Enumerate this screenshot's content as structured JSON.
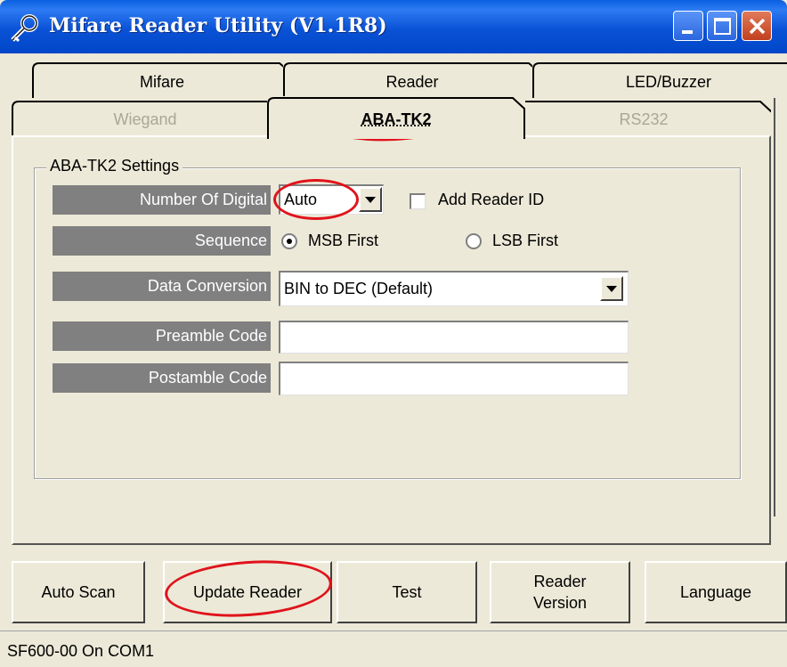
{
  "window": {
    "title": "Mifare Reader Utility (V1.1R8)"
  },
  "tabs": {
    "row1": [
      "Mifare",
      "Reader",
      "LED/Buzzer"
    ],
    "row2": [
      "Wiegand",
      "ABA-TK2",
      "RS232"
    ],
    "active": "ABA-TK2"
  },
  "settings": {
    "group_title": "ABA-TK2 Settings",
    "number_of_digital_label": "Number Of Digital",
    "number_of_digital_value": "Auto",
    "add_reader_id_label": "Add Reader ID",
    "add_reader_id_checked": false,
    "sequence_label": "Sequence",
    "sequence_options": [
      "MSB First",
      "LSB First"
    ],
    "sequence_selected": "MSB First",
    "data_conversion_label": "Data Conversion",
    "data_conversion_value": "BIN to DEC (Default)",
    "preamble_label": "Preamble Code",
    "preamble_value": "",
    "postamble_label": "Postamble Code",
    "postamble_value": ""
  },
  "buttons": {
    "auto_scan": "Auto Scan",
    "update_reader": "Update Reader",
    "test": "Test",
    "reader_version_line1": "Reader",
    "reader_version_line2": "Version",
    "language": "Language"
  },
  "status": {
    "text": "SF600-00 On COM1"
  },
  "annotation_color": "#e0131b"
}
